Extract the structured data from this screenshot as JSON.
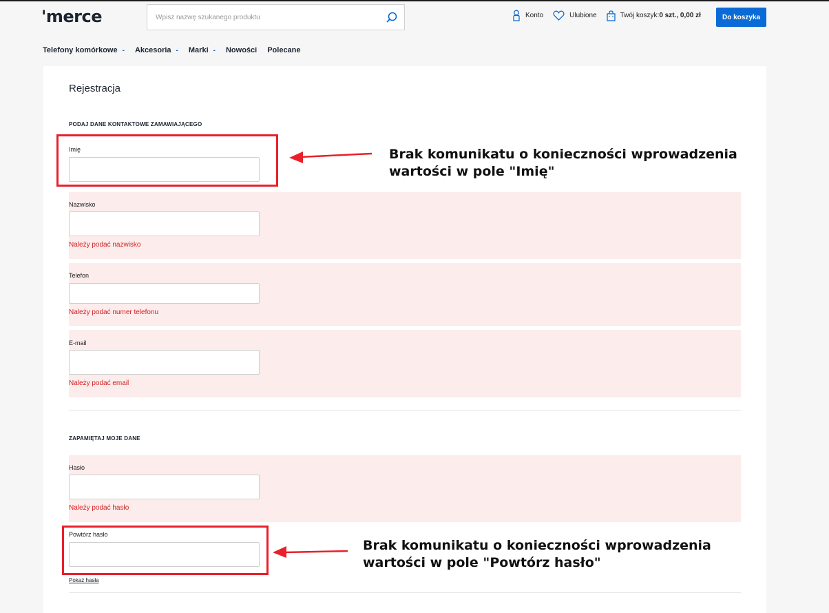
{
  "header": {
    "logo": "'merce",
    "search_placeholder": "Wpisz nazwę szukanego produktu",
    "account_label": "Konto",
    "favorites_label": "Ulubione",
    "cart_prefix": "Twój koszyk:",
    "cart_summary": "0 szt., 0,00 zł",
    "cart_button": "Do koszyka",
    "accent_color": "#0b6bd6"
  },
  "nav": {
    "items": [
      {
        "label": "Telefony komórkowe",
        "dropdown": true
      },
      {
        "label": "Akcesoria",
        "dropdown": true
      },
      {
        "label": "Marki",
        "dropdown": true
      },
      {
        "label": "Nowości",
        "dropdown": false
      },
      {
        "label": "Polecane",
        "dropdown": false
      }
    ]
  },
  "form": {
    "title": "Rejestracja",
    "section_contact": "PODAJ DANE KONTAKTOWE ZAMAWIAJĄCEGO",
    "section_remember": "ZAPAMIĘTAJ MOJE DANE",
    "fields": {
      "first_name": {
        "label": "Imię",
        "value": "",
        "error": ""
      },
      "last_name": {
        "label": "Nazwisko",
        "value": "",
        "error": "Należy podać nazwisko"
      },
      "phone": {
        "label": "Telefon",
        "value": "",
        "error": "Należy podać numer telefonu"
      },
      "email": {
        "label": "E-mail",
        "value": "",
        "error": "Należy podać email"
      },
      "password": {
        "label": "Hasło",
        "value": "",
        "error": "Należy podać hasło"
      },
      "repeat_password": {
        "label": "Powtórz hasło",
        "value": "",
        "error": ""
      }
    },
    "show_passwords": "Pokaż hasła",
    "error_color": "#d21f1f",
    "error_background": "#fcecec"
  },
  "annotations": {
    "first_name_note_line1": "Brak komunikatu o konieczności wprowadzenia",
    "first_name_note_line2": "wartości w pole \"Imię\"",
    "repeat_password_note_line1": "Brak komunikatu o konieczności wprowadzenia",
    "repeat_password_note_line2": "wartości w pole \"Powtórz hasło\"",
    "annotation_color": "#e8202a"
  }
}
